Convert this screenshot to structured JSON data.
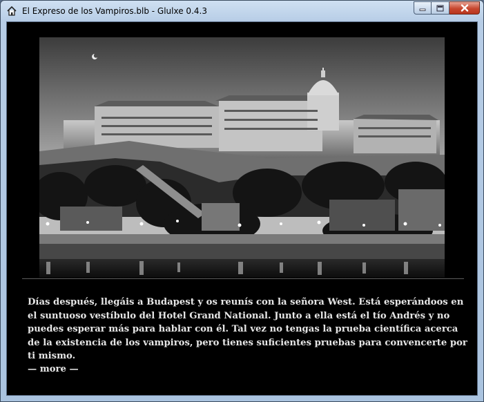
{
  "window": {
    "title": "El Expreso de los Vampiros.blb - Glulxe 0.4.3",
    "buttons": {
      "minimize": "minimize-icon",
      "maximize": "maximize-icon",
      "close": "close-icon"
    }
  },
  "game": {
    "story_text": "Días después, llegáis a Budapest y os reunís con la señora West. Está esperándoos en el suntuoso vestíbulo del Hotel Grand National. Junto a ella está el tío Andrés y no puedes esperar más para hablar con él. Tal vez no tengas la prueba científica acerca de la existencia de los vampiros, pero tienes suficientes pruebas para convencerte por ti mismo.",
    "more_prompt": "— more —"
  },
  "colors": {
    "text": "#e6e6e6",
    "background": "#000000"
  }
}
